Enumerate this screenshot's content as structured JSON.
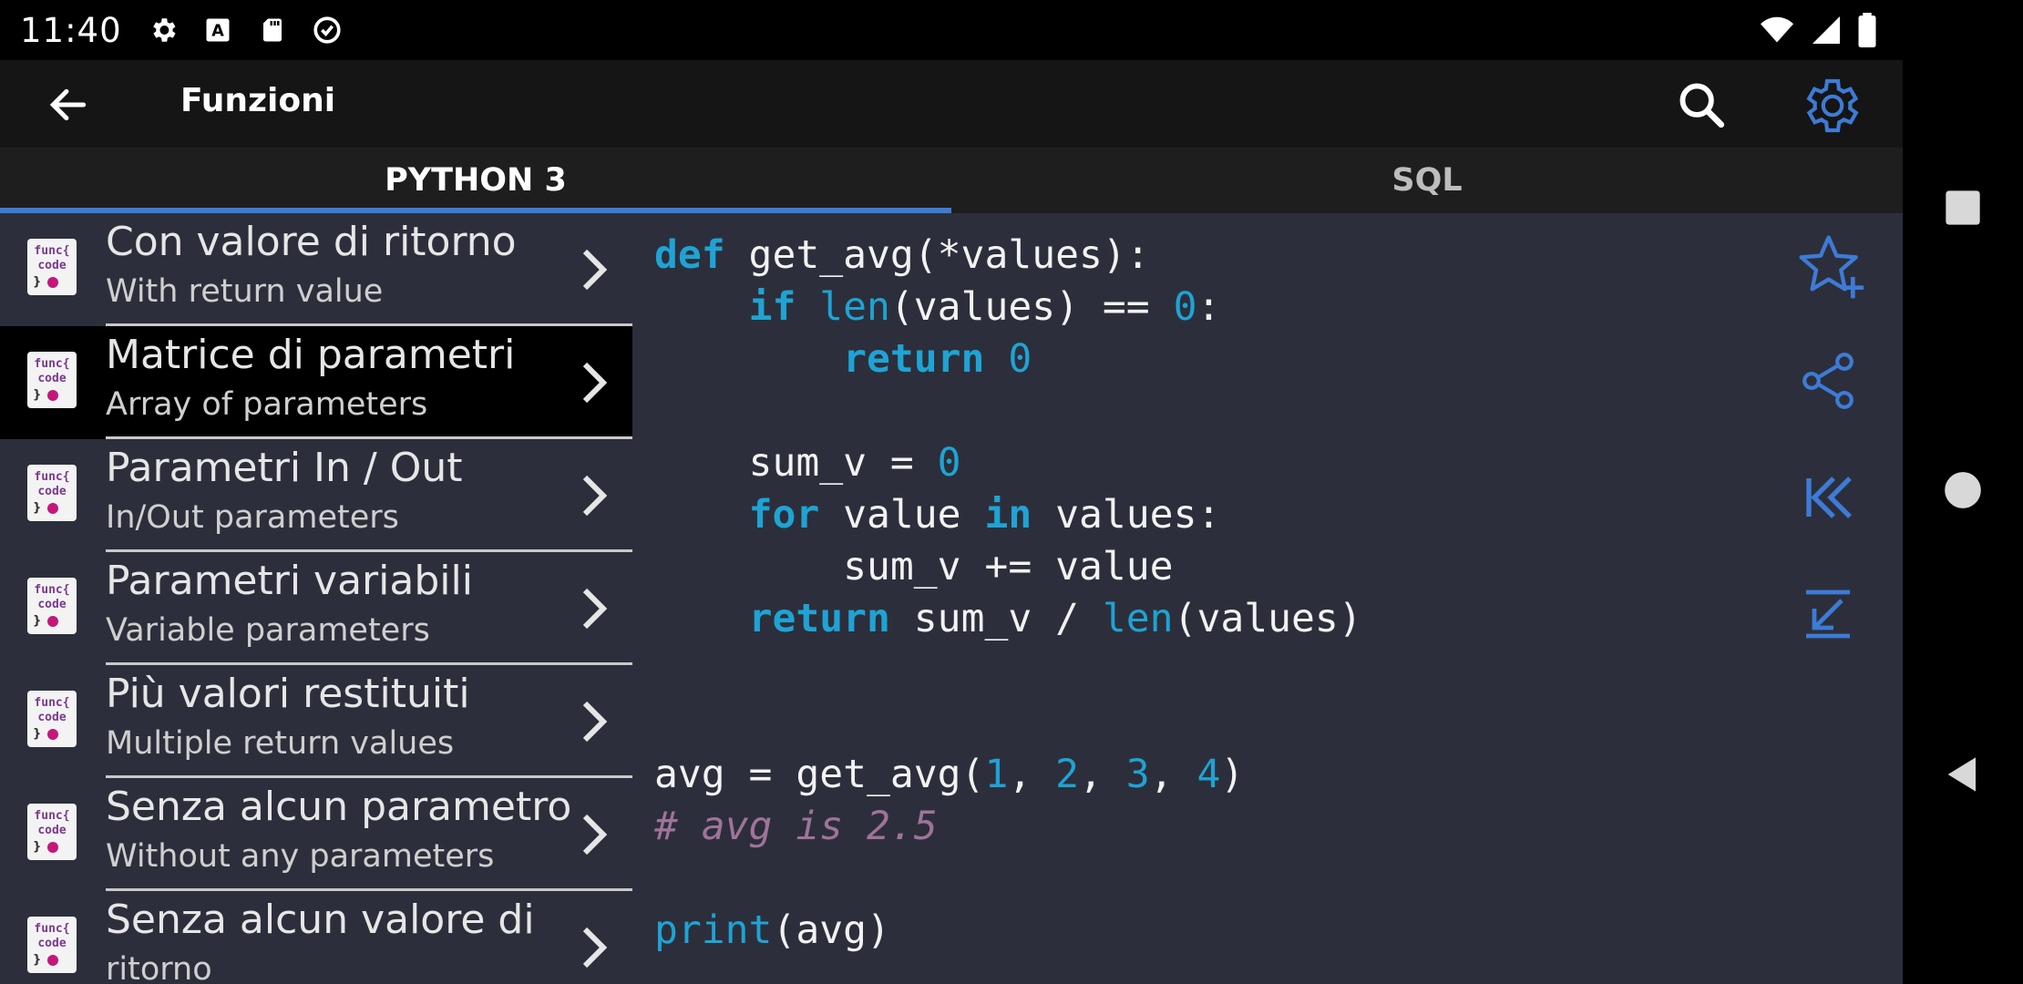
{
  "status_bar": {
    "time": "11:40",
    "icons_left": [
      "gear-icon",
      "accessibility-a-icon",
      "sd-card-icon",
      "data-saver-icon"
    ],
    "icons_right": [
      "wifi-icon",
      "cell-signal-icon",
      "battery-icon"
    ]
  },
  "app_bar": {
    "title": "Funzioni",
    "back_icon": "arrow-left-icon",
    "search_icon": "search-icon",
    "settings_icon": "gear-icon",
    "accent_color": "#3d7bd6"
  },
  "tabs": [
    {
      "label": "PYTHON 3",
      "active": true
    },
    {
      "label": "SQL",
      "active": false
    }
  ],
  "list": {
    "icon_text_top": "func{",
    "icon_text_mid": "code",
    "icon_text_bottom": "}",
    "items": [
      {
        "title": "Con valore di ritorno",
        "subtitle": "With return value",
        "selected": false
      },
      {
        "title": "Matrice di parametri",
        "subtitle": "Array of parameters",
        "selected": true
      },
      {
        "title": "Parametri In / Out",
        "subtitle": "In/Out parameters",
        "selected": false
      },
      {
        "title": "Parametri variabili",
        "subtitle": "Variable parameters",
        "selected": false
      },
      {
        "title": "Più valori restituiti",
        "subtitle": "Multiple return values",
        "selected": false
      },
      {
        "title": "Senza alcun parametro",
        "subtitle": "Without any parameters",
        "selected": false
      },
      {
        "title": "Senza alcun valore di",
        "subtitle": "ritorno",
        "selected": false
      }
    ]
  },
  "code": {
    "lines": [
      [
        {
          "t": "kw",
          "v": "def"
        },
        {
          "t": "tx",
          "v": " get_avg(*values):"
        }
      ],
      [
        {
          "t": "tx",
          "v": "    "
        },
        {
          "t": "kw",
          "v": "if"
        },
        {
          "t": "tx",
          "v": " "
        },
        {
          "t": "fn",
          "v": "len"
        },
        {
          "t": "tx",
          "v": "(values) == "
        },
        {
          "t": "num",
          "v": "0"
        },
        {
          "t": "tx",
          "v": ":"
        }
      ],
      [
        {
          "t": "tx",
          "v": "        "
        },
        {
          "t": "kw",
          "v": "return"
        },
        {
          "t": "tx",
          "v": " "
        },
        {
          "t": "num",
          "v": "0"
        }
      ],
      [
        {
          "t": "tx",
          "v": ""
        }
      ],
      [
        {
          "t": "tx",
          "v": "    sum_v = "
        },
        {
          "t": "num",
          "v": "0"
        }
      ],
      [
        {
          "t": "tx",
          "v": "    "
        },
        {
          "t": "kw",
          "v": "for"
        },
        {
          "t": "tx",
          "v": " value "
        },
        {
          "t": "kw",
          "v": "in"
        },
        {
          "t": "tx",
          "v": " values:"
        }
      ],
      [
        {
          "t": "tx",
          "v": "        sum_v += value"
        }
      ],
      [
        {
          "t": "tx",
          "v": "    "
        },
        {
          "t": "kw",
          "v": "return"
        },
        {
          "t": "tx",
          "v": " sum_v / "
        },
        {
          "t": "fn",
          "v": "len"
        },
        {
          "t": "tx",
          "v": "(values)"
        }
      ],
      [
        {
          "t": "tx",
          "v": ""
        }
      ],
      [
        {
          "t": "tx",
          "v": ""
        }
      ],
      [
        {
          "t": "tx",
          "v": "avg = get_avg("
        },
        {
          "t": "num",
          "v": "1"
        },
        {
          "t": "tx",
          "v": ", "
        },
        {
          "t": "num",
          "v": "2"
        },
        {
          "t": "tx",
          "v": ", "
        },
        {
          "t": "num",
          "v": "3"
        },
        {
          "t": "tx",
          "v": ", "
        },
        {
          "t": "num",
          "v": "4"
        },
        {
          "t": "tx",
          "v": ")"
        }
      ],
      [
        {
          "t": "cm",
          "v": "# avg is 2.5"
        }
      ],
      [
        {
          "t": "tx",
          "v": ""
        }
      ],
      [
        {
          "t": "fn",
          "v": "print"
        },
        {
          "t": "tx",
          "v": "(avg)"
        }
      ]
    ]
  },
  "actions": [
    "star-plus-icon",
    "share-icon",
    "skip-to-start-icon",
    "arrow-down-left-icon"
  ],
  "nav_bar": [
    "recents-square-icon",
    "home-circle-icon",
    "back-triangle-icon"
  ]
}
